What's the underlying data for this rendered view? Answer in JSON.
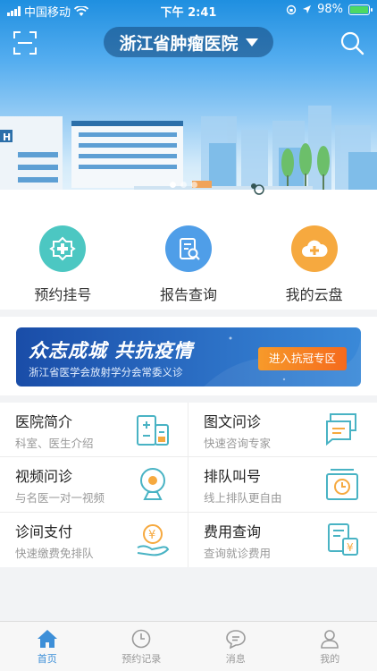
{
  "status_bar": {
    "carrier": "中国移动",
    "time": "下午 2:41",
    "battery": "98%",
    "battery_level": 0.98
  },
  "header": {
    "hospital_name": "浙江省肿瘤医院",
    "scan_icon": "scan-icon",
    "search_icon": "search-icon"
  },
  "carousel": {
    "slides": 3,
    "active_index": 0
  },
  "quick_actions": [
    {
      "label": "预约挂号",
      "icon": "registration-icon",
      "color": "#4cc7c2"
    },
    {
      "label": "报告查询",
      "icon": "report-search-icon",
      "color": "#4f9ee8"
    },
    {
      "label": "我的云盘",
      "icon": "cloud-drive-icon",
      "color": "#f6a93f"
    }
  ],
  "banner": {
    "title": "众志成城 共抗疫情",
    "subtitle": "浙江省医学会放射学分会常委义诊",
    "cta": "进入抗冠专区"
  },
  "services": [
    {
      "title": "医院简介",
      "subtitle": "科室、医生介绍",
      "icon": "hospital-info-icon"
    },
    {
      "title": "图文问诊",
      "subtitle": "快速咨询专家",
      "icon": "chat-consult-icon"
    },
    {
      "title": "视频问诊",
      "subtitle": "与名医一对一视频",
      "icon": "video-consult-icon"
    },
    {
      "title": "排队叫号",
      "subtitle": "线上排队更自由",
      "icon": "queue-icon"
    },
    {
      "title": "诊间支付",
      "subtitle": "快速缴费免排队",
      "icon": "payment-icon"
    },
    {
      "title": "费用查询",
      "subtitle": "查询就诊费用",
      "icon": "fee-query-icon"
    }
  ],
  "tabbar": [
    {
      "label": "首页",
      "icon": "home-icon",
      "active": true
    },
    {
      "label": "预约记录",
      "icon": "clock-icon",
      "active": false
    },
    {
      "label": "消息",
      "icon": "message-icon",
      "active": false
    },
    {
      "label": "我的",
      "icon": "user-icon",
      "active": false
    }
  ],
  "colors": {
    "accent": "#3d8fd8",
    "line_icon": "#49b3c4",
    "inactive": "#9a9a9a"
  }
}
